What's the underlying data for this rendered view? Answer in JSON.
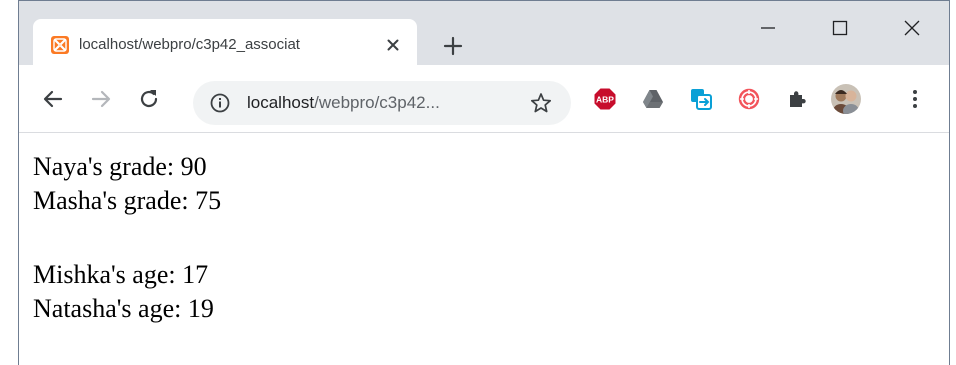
{
  "tab": {
    "title": "localhost/webpro/c3p42_associat",
    "favicon": "xampp-icon"
  },
  "window_controls": {
    "minimize": "minimize-icon",
    "maximize": "maximize-icon",
    "close": "close-icon"
  },
  "omnibox": {
    "host": "localhost",
    "path": "/webpro/c3p42..."
  },
  "extensions": [
    "adblock-plus-icon",
    "google-drive-icon",
    "copy-extension-icon",
    "swirl-extension-icon",
    "puzzle-extensions-icon"
  ],
  "colors": {
    "tabstrip": "#dee1e6",
    "favicon": "#fb7a24",
    "abp": "#c70d2c",
    "copy_ext": "#0aa0d6",
    "swirl_ext": "#f2545b"
  },
  "page": {
    "grades": [
      {
        "text": "Naya's grade: 90"
      },
      {
        "text": "Masha's grade: 75"
      }
    ],
    "ages": [
      {
        "text": "Mishka's age: 17"
      },
      {
        "text": "Natasha's age: 19"
      }
    ]
  }
}
